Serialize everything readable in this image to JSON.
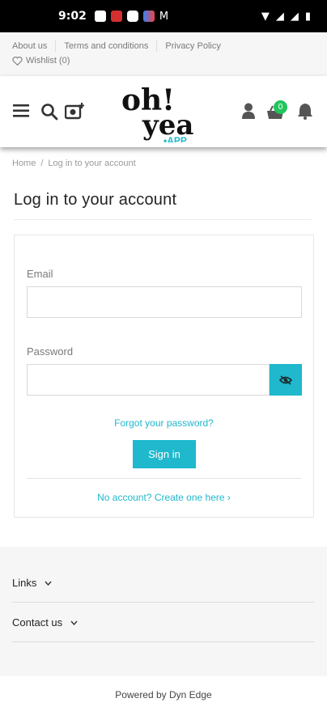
{
  "status_bar": {
    "time": "9:02"
  },
  "top_links": {
    "about": "About us",
    "terms": "Terms and conditions",
    "privacy": "Privacy Policy",
    "wishlist": "Wishlist (0)"
  },
  "header": {
    "logo_line1": "oh!",
    "logo_line2": "yea",
    "logo_line3": "•APP",
    "cart_count": "0",
    "icons": [
      "menu-icon",
      "search-icon",
      "camera-search-icon",
      "user-icon",
      "cart-icon",
      "bell-icon"
    ]
  },
  "breadcrumb": {
    "home": "Home",
    "current": "Log in to your account"
  },
  "page_title": "Log in to your account",
  "form": {
    "email_label": "Email",
    "email_value": "",
    "password_label": "Password",
    "password_value": "",
    "forgot_link": "Forgot your password?",
    "signin_label": "Sign in",
    "create_account_link": "No account? Create one here ›"
  },
  "footer": {
    "links_label": "Links",
    "contact_label": "Contact us",
    "powered_by": "Powered by Dyn Edge"
  },
  "colors": {
    "accent": "#1fb8cd",
    "badge": "#22c55e",
    "logo_magenta": "#e0147a",
    "text": "#232323"
  }
}
